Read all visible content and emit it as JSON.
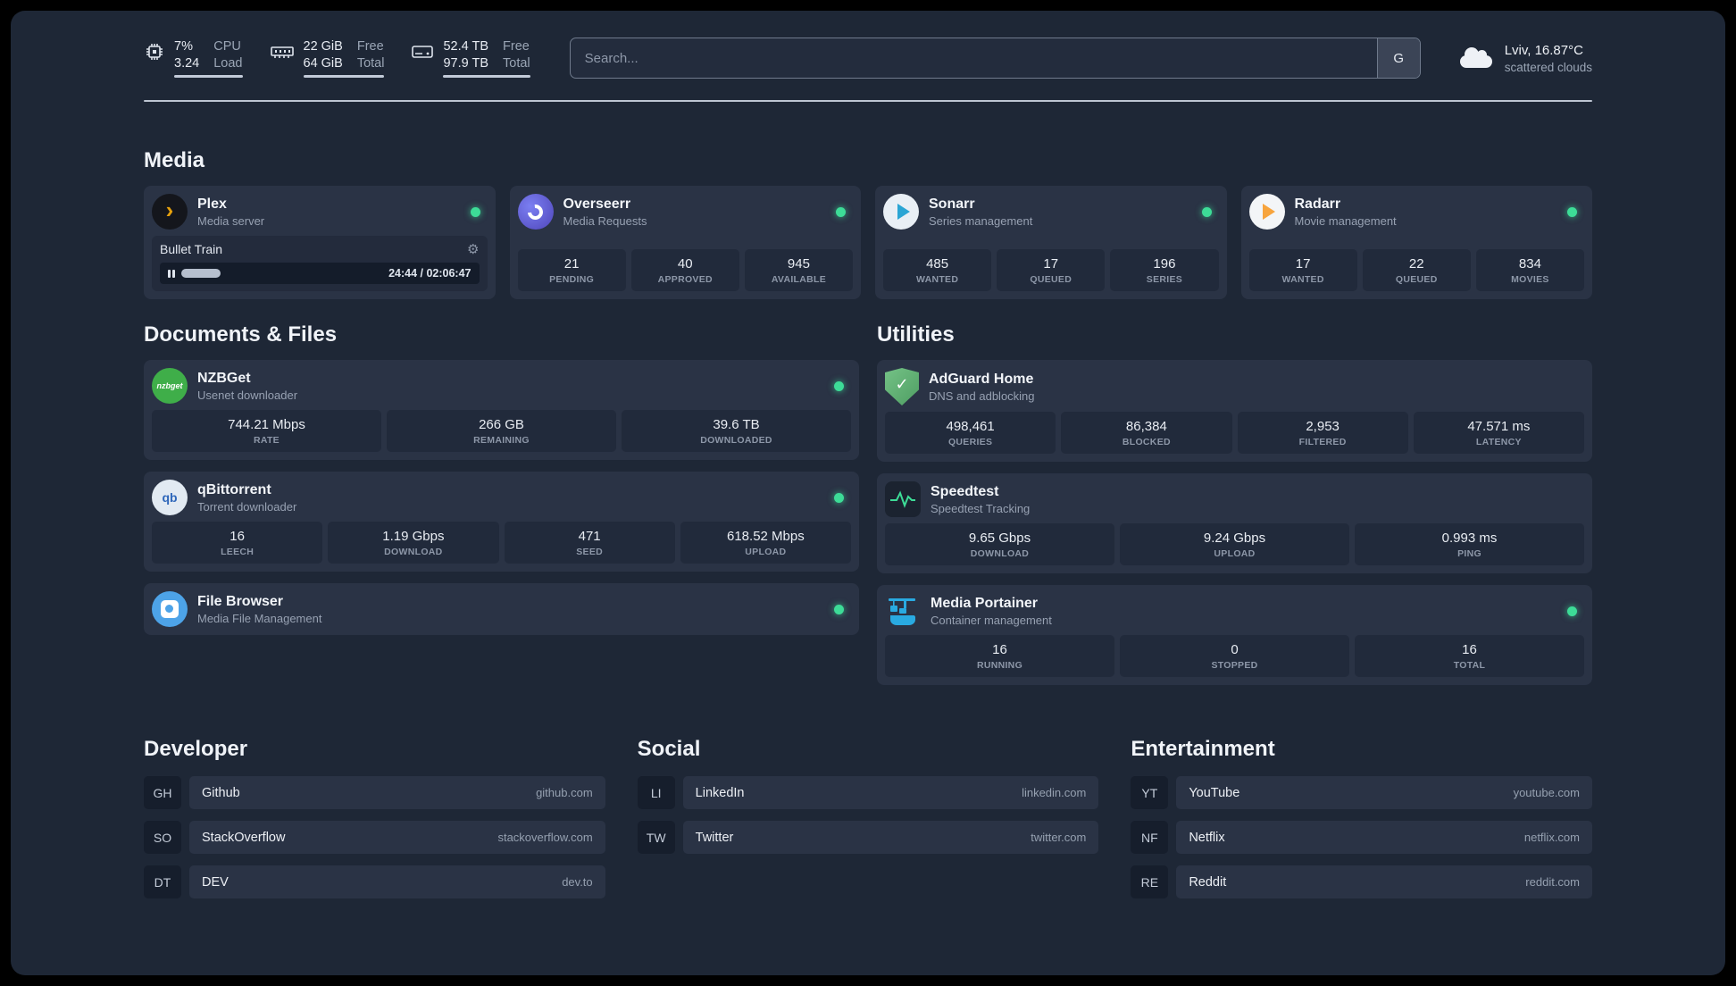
{
  "theme": {
    "panel_bg": "#1e2736",
    "card_bg": "#2a3345",
    "stat_bg": "#212a3b",
    "status_green": "#3ddc97",
    "plex_amber": "#e5a00d",
    "sonarr_blue": "#2aa5d4",
    "radarr_amber": "#f7a43d",
    "overseerr_purple": "#5f5bd6",
    "nzbget_green": "#3fae49",
    "qbittorrent_blue": "#2f67ba",
    "filebrowser_blue": "#4da3e8",
    "adguard_green": "#5ca96e",
    "speedtest_green": "#3ddc97",
    "portainer_blue": "#29aae1"
  },
  "icons": {
    "gear": "⚙",
    "check": "✓",
    "plex_chevron": "›",
    "nzbget_text": "nzbget",
    "qb_text": "qb"
  },
  "topbar": {
    "cpu": {
      "value_top": "7%",
      "label_top": "CPU",
      "value_bottom": "3.24",
      "label_bottom": "Load"
    },
    "memory": {
      "value_top": "22 GiB",
      "label_top": "Free",
      "value_bottom": "64 GiB",
      "label_bottom": "Total"
    },
    "disk": {
      "value_top": "52.4 TB",
      "label_top": "Free",
      "value_bottom": "97.9 TB",
      "label_bottom": "Total"
    },
    "search": {
      "placeholder": "Search...",
      "provider_badge": "G"
    },
    "weather": {
      "location": "Lviv, 16.87°C",
      "condition": "scattered clouds"
    }
  },
  "groups": {
    "media": {
      "title": "Media",
      "plex": {
        "name": "Plex",
        "desc": "Media server",
        "now_playing": "Bullet Train",
        "time": "24:44 / 02:06:47"
      },
      "overseerr": {
        "name": "Overseerr",
        "desc": "Media Requests",
        "stats": [
          {
            "value": "21",
            "label": "PENDING"
          },
          {
            "value": "40",
            "label": "APPROVED"
          },
          {
            "value": "945",
            "label": "AVAILABLE"
          }
        ]
      },
      "sonarr": {
        "name": "Sonarr",
        "desc": "Series management",
        "stats": [
          {
            "value": "485",
            "label": "WANTED"
          },
          {
            "value": "17",
            "label": "QUEUED"
          },
          {
            "value": "196",
            "label": "SERIES"
          }
        ]
      },
      "radarr": {
        "name": "Radarr",
        "desc": "Movie management",
        "stats": [
          {
            "value": "17",
            "label": "WANTED"
          },
          {
            "value": "22",
            "label": "QUEUED"
          },
          {
            "value": "834",
            "label": "MOVIES"
          }
        ]
      }
    },
    "documents": {
      "title": "Documents & Files",
      "nzbget": {
        "name": "NZBGet",
        "desc": "Usenet downloader",
        "stats": [
          {
            "value": "744.21 Mbps",
            "label": "RATE"
          },
          {
            "value": "266 GB",
            "label": "REMAINING"
          },
          {
            "value": "39.6 TB",
            "label": "DOWNLOADED"
          }
        ]
      },
      "qbittorrent": {
        "name": "qBittorrent",
        "desc": "Torrent downloader",
        "stats": [
          {
            "value": "16",
            "label": "LEECH"
          },
          {
            "value": "1.19 Gbps",
            "label": "DOWNLOAD"
          },
          {
            "value": "471",
            "label": "SEED"
          },
          {
            "value": "618.52 Mbps",
            "label": "UPLOAD"
          }
        ]
      },
      "filebrowser": {
        "name": "File Browser",
        "desc": "Media File Management"
      }
    },
    "utilities": {
      "title": "Utilities",
      "adguard": {
        "name": "AdGuard Home",
        "desc": "DNS and adblocking",
        "stats": [
          {
            "value": "498,461",
            "label": "QUERIES"
          },
          {
            "value": "86,384",
            "label": "BLOCKED"
          },
          {
            "value": "2,953",
            "label": "FILTERED"
          },
          {
            "value": "47.571 ms",
            "label": "LATENCY"
          }
        ]
      },
      "speedtest": {
        "name": "Speedtest",
        "desc": "Speedtest Tracking",
        "stats": [
          {
            "value": "9.65 Gbps",
            "label": "DOWNLOAD"
          },
          {
            "value": "9.24 Gbps",
            "label": "UPLOAD"
          },
          {
            "value": "0.993 ms",
            "label": "PING"
          }
        ]
      },
      "portainer": {
        "name": "Media Portainer",
        "desc": "Container management",
        "stats": [
          {
            "value": "16",
            "label": "RUNNING"
          },
          {
            "value": "0",
            "label": "STOPPED"
          },
          {
            "value": "16",
            "label": "TOTAL"
          }
        ]
      }
    }
  },
  "bookmarks": [
    {
      "title": "Developer",
      "items": [
        {
          "abbr": "GH",
          "label": "Github",
          "url": "github.com"
        },
        {
          "abbr": "SO",
          "label": "StackOverflow",
          "url": "stackoverflow.com"
        },
        {
          "abbr": "DT",
          "label": "DEV",
          "url": "dev.to"
        }
      ]
    },
    {
      "title": "Social",
      "items": [
        {
          "abbr": "LI",
          "label": "LinkedIn",
          "url": "linkedin.com"
        },
        {
          "abbr": "TW",
          "label": "Twitter",
          "url": "twitter.com"
        }
      ]
    },
    {
      "title": "Entertainment",
      "items": [
        {
          "abbr": "YT",
          "label": "YouTube",
          "url": "youtube.com"
        },
        {
          "abbr": "NF",
          "label": "Netflix",
          "url": "netflix.com"
        },
        {
          "abbr": "RE",
          "label": "Reddit",
          "url": "reddit.com"
        }
      ]
    }
  ]
}
